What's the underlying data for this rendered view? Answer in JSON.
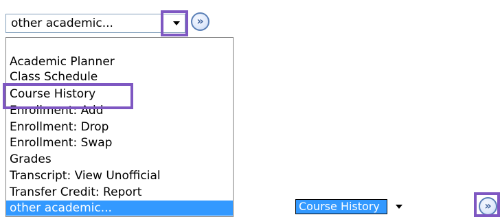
{
  "top_select": {
    "value": "other academic...",
    "dropdown_icon": "chevron-down-icon"
  },
  "go_button": {
    "label": "»",
    "icon": "double-chevron-right-icon"
  },
  "dropdown": {
    "items": [
      {
        "label": "Academic Planner"
      },
      {
        "label": "Class Schedule"
      },
      {
        "label": "Course History"
      },
      {
        "label": "Enrollment: Add"
      },
      {
        "label": "Enrollment: Drop"
      },
      {
        "label": "Enrollment: Swap"
      },
      {
        "label": "Grades"
      },
      {
        "label": "Transcript: View Unofficial"
      },
      {
        "label": "Transfer Credit: Report"
      },
      {
        "label": "other academic..."
      }
    ],
    "selected_index": 9
  },
  "bottom_select": {
    "value": "Course History"
  },
  "colors": {
    "highlight_border": "#7e57c2",
    "selection_bg": "#3399ff",
    "go_button_border": "#5a7fb6"
  }
}
